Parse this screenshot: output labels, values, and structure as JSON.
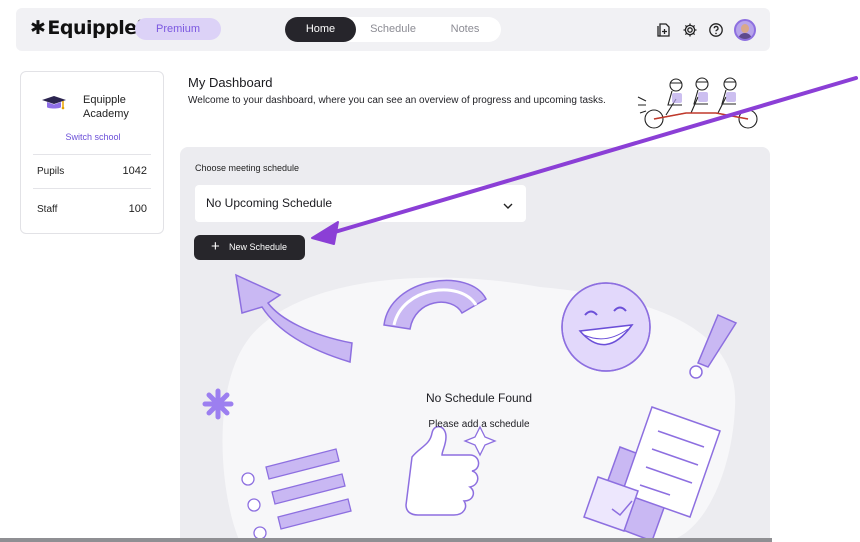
{
  "brand": {
    "logo_text": "Equipple",
    "trademark": "®",
    "plan_badge": "Premium"
  },
  "nav": {
    "tabs": [
      {
        "label": "Home",
        "active": true
      },
      {
        "label": "Schedule",
        "active": false
      },
      {
        "label": "Notes",
        "active": false
      }
    ],
    "icons": [
      "add-document-icon",
      "gear-icon",
      "help-icon",
      "avatar"
    ]
  },
  "school": {
    "name": "Equipple Academy",
    "switch_label": "Switch school",
    "stats": [
      {
        "label": "Pupils",
        "value": "1042"
      },
      {
        "label": "Staff",
        "value": "100"
      }
    ]
  },
  "dashboard": {
    "title": "My Dashboard",
    "subtitle": "Welcome to your dashboard, where you can see an overview of progress and upcoming tasks."
  },
  "schedule": {
    "choose_label": "Choose meeting schedule",
    "selected": "No Upcoming Schedule",
    "new_button": "New Schedule",
    "empty_title": "No Schedule Found",
    "empty_subtitle": "Please add a schedule"
  },
  "colors": {
    "accent": "#7b57e0",
    "accent_light": "#dcd2f7",
    "dark_button": "#27262b",
    "panel_bg": "#ececf0",
    "arrow": "#8b3fd6"
  }
}
